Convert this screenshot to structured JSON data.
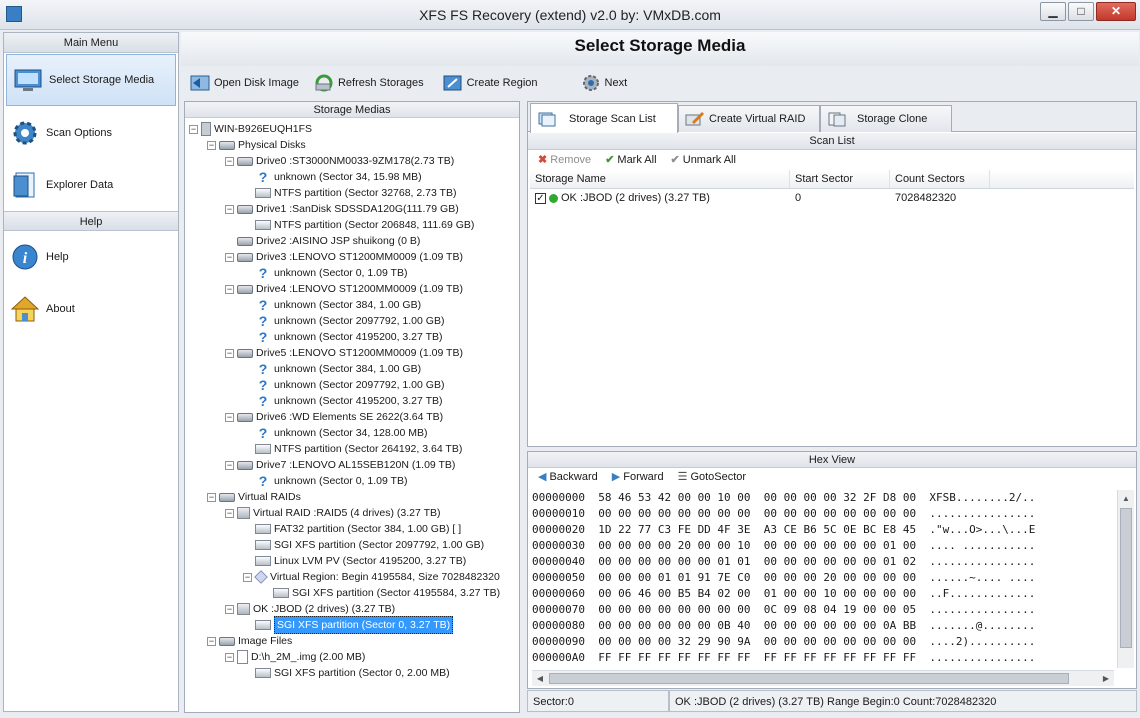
{
  "window": {
    "title": "XFS FS Recovery (extend) v2.0 by: VMxDB.com",
    "min": "▁",
    "max": "□",
    "close": "✕"
  },
  "sidebar": {
    "main_menu_label": "Main Menu",
    "help_label": "Help",
    "items": [
      {
        "label": "Select Storage Media",
        "icon": "monitor-icon"
      },
      {
        "label": "Scan Options",
        "icon": "gear-icon"
      },
      {
        "label": "Explorer Data",
        "icon": "document-icon"
      }
    ],
    "help_items": [
      {
        "label": "Help",
        "icon": "info-icon"
      },
      {
        "label": "About",
        "icon": "home-icon"
      }
    ]
  },
  "header": {
    "title": "Select Storage Media"
  },
  "toolbar": {
    "open": "Open Disk Image",
    "refresh": "Refresh Storages",
    "create_region": "Create Region",
    "next": "Next"
  },
  "tree": {
    "panel_title": "Storage Medias",
    "nodes": [
      {
        "text": "WIN-B926EUQH1FS",
        "icon": "pc",
        "toggle": "−"
      },
      {
        "text": "Physical Disks",
        "icon": "disk",
        "toggle": "−"
      },
      {
        "text": "Drive0 :ST3000NM0033-9ZM178(2.73 TB)",
        "icon": "disk",
        "toggle": "−"
      },
      {
        "text": "unknown (Sector 34, 15.98 MB)",
        "icon": "q"
      },
      {
        "text": "NTFS partition (Sector 32768, 2.73 TB)",
        "icon": "part"
      },
      {
        "text": "Drive1 :SanDisk SDSSDA120G(111.79 GB)",
        "icon": "disk",
        "toggle": "−"
      },
      {
        "text": "NTFS partition (Sector 206848, 111.69 GB)",
        "icon": "part"
      },
      {
        "text": "Drive2 :AISINO  JSP shuikong  (0 B)",
        "icon": "disk"
      },
      {
        "text": "Drive3 :LENOVO  ST1200MM0009    (1.09 TB)",
        "icon": "disk",
        "toggle": "−"
      },
      {
        "text": "unknown (Sector 0, 1.09 TB)",
        "icon": "q"
      },
      {
        "text": "Drive4 :LENOVO  ST1200MM0009    (1.09 TB)",
        "icon": "disk",
        "toggle": "−"
      },
      {
        "text": "unknown (Sector 384, 1.00 GB)",
        "icon": "q"
      },
      {
        "text": "unknown (Sector 2097792, 1.00 GB)",
        "icon": "q"
      },
      {
        "text": "unknown (Sector 4195200, 3.27 TB)",
        "icon": "q"
      },
      {
        "text": "Drive5 :LENOVO  ST1200MM0009    (1.09 TB)",
        "icon": "disk",
        "toggle": "−"
      },
      {
        "text": "unknown (Sector 384, 1.00 GB)",
        "icon": "q"
      },
      {
        "text": "unknown (Sector 2097792, 1.00 GB)",
        "icon": "q"
      },
      {
        "text": "unknown (Sector 4195200, 3.27 TB)",
        "icon": "q"
      },
      {
        "text": "Drive6 :WD      Elements SE 2622(3.64 TB)",
        "icon": "disk",
        "toggle": "−"
      },
      {
        "text": "unknown (Sector 34, 128.00 MB)",
        "icon": "q"
      },
      {
        "text": "NTFS partition (Sector 264192, 3.64 TB)",
        "icon": "part"
      },
      {
        "text": "Drive7 :LENOVO  AL15SEB120N     (1.09 TB)",
        "icon": "disk",
        "toggle": "−"
      },
      {
        "text": "unknown (Sector 0, 1.09 TB)",
        "icon": "q"
      },
      {
        "text": "Virtual RAIDs",
        "icon": "disk",
        "toggle": "−"
      },
      {
        "text": "Virtual RAID :RAID5 (4 drives) (3.27 TB)",
        "icon": "raid",
        "toggle": "−"
      },
      {
        "text": "FAT32 partition (Sector 384, 1.00 GB) [          ]",
        "icon": "part"
      },
      {
        "text": "SGI XFS partition (Sector 2097792, 1.00 GB)",
        "icon": "part"
      },
      {
        "text": "Linux LVM PV (Sector 4195200, 3.27 TB)",
        "icon": "part"
      },
      {
        "text": "Virtual Region: Begin 4195584, Size 7028482320",
        "icon": "region",
        "toggle": "−"
      },
      {
        "text": "SGI XFS partition (Sector 4195584, 3.27 TB)",
        "icon": "part"
      },
      {
        "text": "OK :JBOD (2 drives) (3.27 TB)",
        "icon": "raid",
        "toggle": "−"
      },
      {
        "text": "SGI XFS partition (Sector 0, 3.27 TB)",
        "icon": "part",
        "selected": true
      },
      {
        "text": "Image Files",
        "icon": "disk",
        "toggle": "−"
      },
      {
        "text": "D:\\h_2M_.img (2.00 MB)",
        "icon": "file",
        "toggle": "−"
      },
      {
        "text": "SGI XFS partition (Sector 0, 2.00 MB)",
        "icon": "part"
      }
    ]
  },
  "tabs": [
    "Storage Scan List",
    "Create Virtual RAID",
    "Storage Clone"
  ],
  "scan_list": {
    "title": "Scan List",
    "actions": {
      "remove": "Remove",
      "mark_all": "Mark All",
      "unmark_all": "Unmark All"
    },
    "columns": [
      "Storage Name",
      "Start Sector",
      "Count Sectors"
    ],
    "rows": [
      {
        "name": "OK :JBOD (2 drives) (3.27 TB)",
        "start": "0",
        "count": "7028482320",
        "checked": "✓"
      }
    ]
  },
  "hex": {
    "title": "Hex View",
    "actions": {
      "backward": "Backward",
      "forward": "Forward",
      "goto": "GotoSector"
    },
    "lines": [
      "00000000  58 46 53 42 00 00 10 00  00 00 00 00 32 2F D8 00  XFSB........2/..",
      "00000010  00 00 00 00 00 00 00 00  00 00 00 00 00 00 00 00  ................",
      "00000020  1D 22 77 C3 FE DD 4F 3E  A3 CE B6 5C 0E BC E8 45  .\"w...O>...\\...E",
      "00000030  00 00 00 00 20 00 00 10  00 00 00 00 00 00 01 00  .... ...........",
      "00000040  00 00 00 00 00 00 01 01  00 00 00 00 00 00 01 02  ................",
      "00000050  00 00 00 01 01 91 7E C0  00 00 00 20 00 00 00 00  ......~.... ....",
      "00000060  00 06 46 00 B5 B4 02 00  01 00 00 10 00 00 00 00  ..F.............",
      "00000070  00 00 00 00 00 00 00 00  0C 09 08 04 19 00 00 05  ................",
      "00000080  00 00 00 00 00 00 0B 40  00 00 00 00 00 00 0A BB  .......@........",
      "00000090  00 00 00 00 32 29 90 9A  00 00 00 00 00 00 00 00  ....2)..........",
      "000000A0  FF FF FF FF FF FF FF FF  FF FF FF FF FF FF FF FF  ................"
    ]
  },
  "status": {
    "sector": "Sector:0",
    "info": "OK :JBOD (2 drives) (3.27 TB) Range Begin:0 Count:7028482320"
  }
}
